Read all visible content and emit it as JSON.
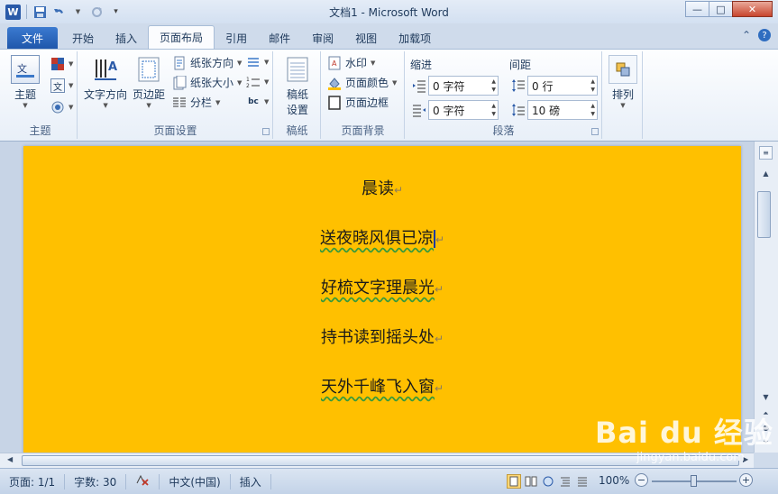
{
  "window": {
    "title": "文档1 - Microsoft Word",
    "app_icon_letter": "W",
    "controls": {
      "minimize": "—",
      "maximize": "□",
      "close": "✕"
    }
  },
  "quick_access": {
    "undo_icon": "undo-icon",
    "redo_icon": "redo-icon",
    "save_icon": "save-icon"
  },
  "tabs": [
    {
      "label": "文件"
    },
    {
      "label": "开始"
    },
    {
      "label": "插入"
    },
    {
      "label": "页面布局"
    },
    {
      "label": "引用"
    },
    {
      "label": "邮件"
    },
    {
      "label": "审阅"
    },
    {
      "label": "视图"
    },
    {
      "label": "加载项"
    }
  ],
  "ribbon": {
    "theme": {
      "label": "主题",
      "group": "主题"
    },
    "page_setup": {
      "group": "页面设置",
      "text_direction": "文字方向",
      "margins": "页边距",
      "orientation": "纸张方向",
      "size": "纸张大小",
      "columns": "分栏"
    },
    "draft": {
      "group": "稿纸",
      "label_line1": "稿纸",
      "label_line2": "设置"
    },
    "background": {
      "group": "页面背景",
      "watermark": "水印",
      "page_color": "页面颜色",
      "page_borders": "页面边框"
    },
    "paragraph": {
      "group": "段落",
      "indent_label": "缩进",
      "spacing_label": "间距",
      "indent_left": "0 字符",
      "indent_right": "0 字符",
      "spacing_before": "0 行",
      "spacing_after": "10 磅"
    },
    "arrange": {
      "label": "排列"
    }
  },
  "document": {
    "page_color": "#ffc000",
    "lines": [
      "晨读",
      "送夜晓风俱已凉",
      "好梳文字理晨光",
      "持书读到摇头处",
      "天外千峰飞入窗"
    ],
    "paragraph_mark": "↵"
  },
  "status_bar": {
    "page": "页面: 1/1",
    "words": "字数: 30",
    "language": "中文(中国)",
    "mode": "插入",
    "zoom": "100%"
  },
  "watermark": {
    "brand": "Bai du 经验",
    "url": "jingyan.baidu.com"
  }
}
